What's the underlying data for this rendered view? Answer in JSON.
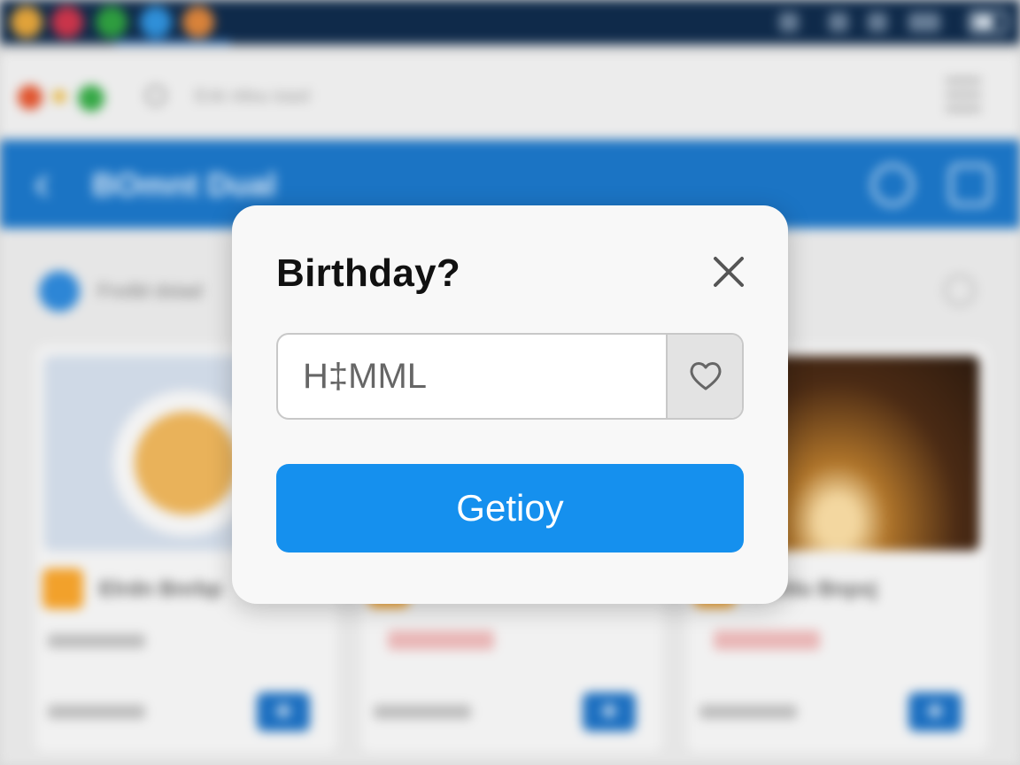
{
  "background": {
    "header_title": "BOmnt Dual",
    "address_bar_text": "Enk ntlou ioaxl",
    "filter_label": "Fnxlbl dstad",
    "cards": [
      {
        "title": "Elrdn Bnrbp",
        "meta": "Bnp Rmkt"
      },
      {
        "title": "",
        "meta": "Bnp Rmkt"
      },
      {
        "title": "Bofdu Bnpxj",
        "meta": "Bnp Rmkt"
      }
    ],
    "colors": {
      "topbar": "#0f2a4a",
      "header": "#1b74c4",
      "accent_add": "#1c6fc0"
    }
  },
  "dialog": {
    "title": "Birthday?",
    "close_icon": "close-icon",
    "input": {
      "placeholder": "H‡MML",
      "value": ""
    },
    "favorite_icon": "heart-icon",
    "primary_button": "Getioy",
    "colors": {
      "primary": "#1590ee",
      "surface": "#f8f8f8"
    }
  }
}
